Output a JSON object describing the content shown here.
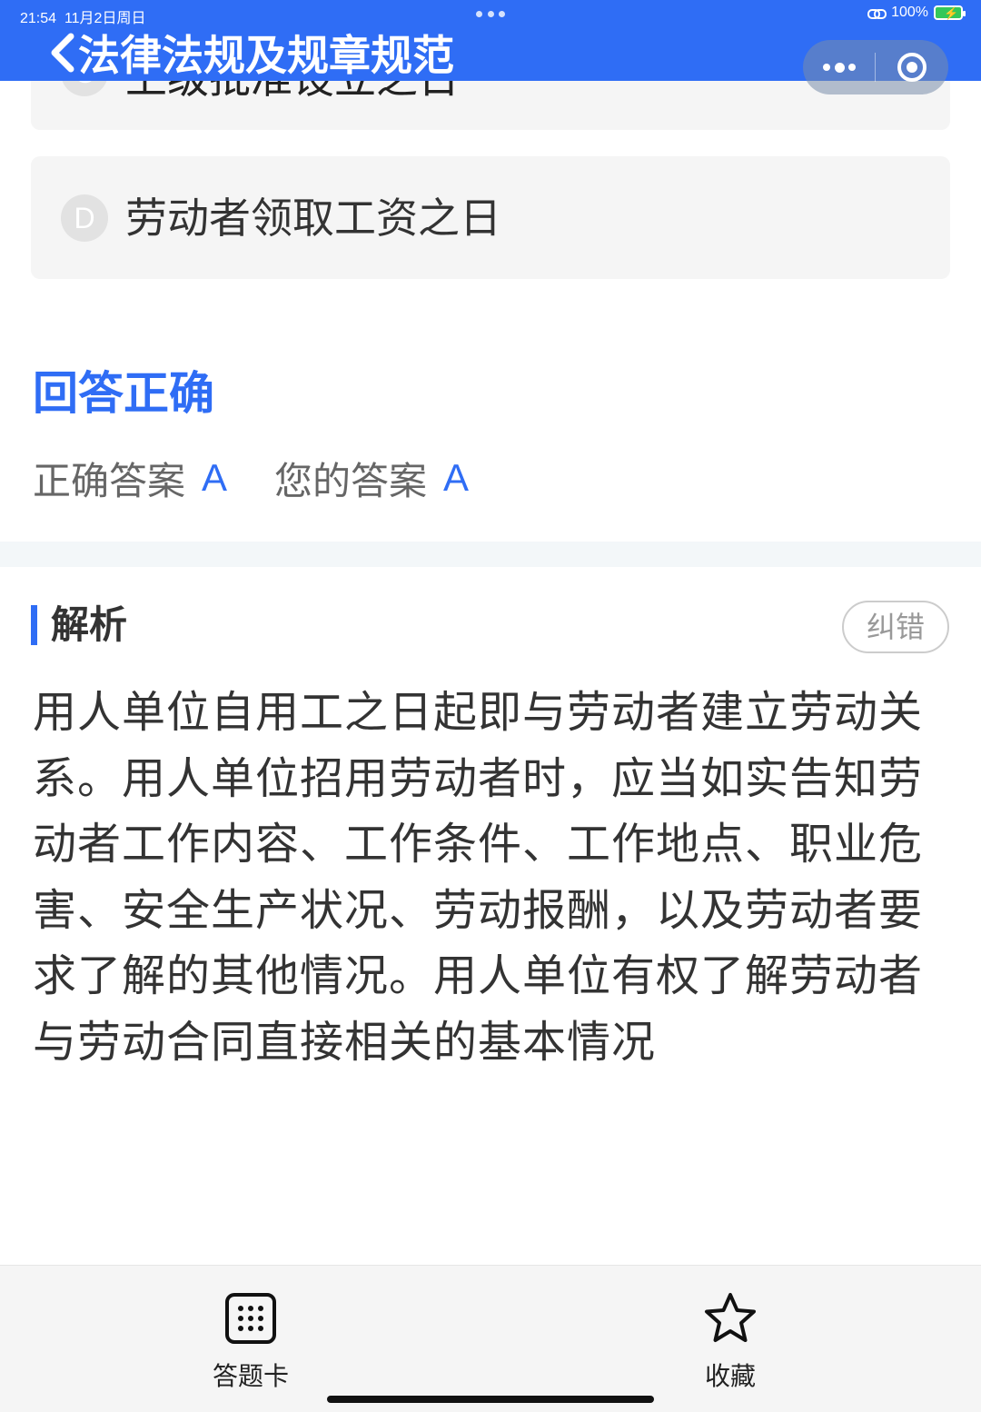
{
  "status_bar": {
    "time": "21:54",
    "date": "11月2日周日",
    "battery": "100%"
  },
  "header": {
    "title": "法律法规及规章规范"
  },
  "options": [
    {
      "letter": "C",
      "text": "上级批准设立之日"
    },
    {
      "letter": "D",
      "text": "劳动者领取工资之日"
    }
  ],
  "result": {
    "title": "回答正确",
    "correct_answer_label": "正确答案",
    "correct_answer": "A",
    "your_answer_label": "您的答案",
    "your_answer": "A"
  },
  "analysis": {
    "title": "解析",
    "report_button": "纠错",
    "text": "用人单位自用工之日起即与劳动者建立劳动关系。用人单位招用劳动者时，应当如实告知劳动者工作内容、工作条件、工作地点、职业危害、安全生产状况、劳动报酬，以及劳动者要求了解的其他情况。用人单位有权了解劳动者与劳动合同直接相关的基本情况"
  },
  "bottom_bar": {
    "answer_card_label": "答题卡",
    "favorite_label": "收藏"
  },
  "colors": {
    "accent": "#2f6df5",
    "header_bg": "#2f6df5",
    "card_bg": "#f5f5f5"
  }
}
